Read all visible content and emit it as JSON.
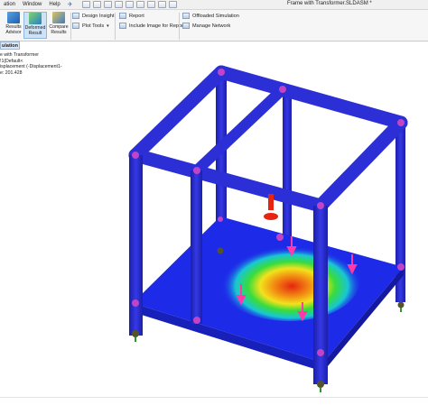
{
  "menubar": {
    "items": [
      "ation",
      "Window",
      "Help"
    ],
    "document_title": "Frame with Transformer.SLDASM *"
  },
  "ribbon": {
    "results_advisor": "Results Advisor",
    "deformed_result": "Deformed Result",
    "compare_results": "Compare Results",
    "design_insight": "Design Insight",
    "plot_tools": "Plot Tools",
    "report": "Report",
    "include_image": "Include Image for Report",
    "offloaded_simulation": "Offloaded Simulation",
    "manage_network": "Manage Network"
  },
  "tab": {
    "label": "ulation"
  },
  "tree": {
    "line1": "e with Transformer",
    "line2": "!1(Default<",
    "line3": "isplacement (-Displacement1-",
    "line4": "e: 201.428"
  },
  "colors": {
    "frame": "#2c2fd6",
    "plate": "#1d2be8",
    "hot": "#e52510",
    "pin_marker": "#c044c8",
    "load_arrow": "#ff3aa8"
  }
}
